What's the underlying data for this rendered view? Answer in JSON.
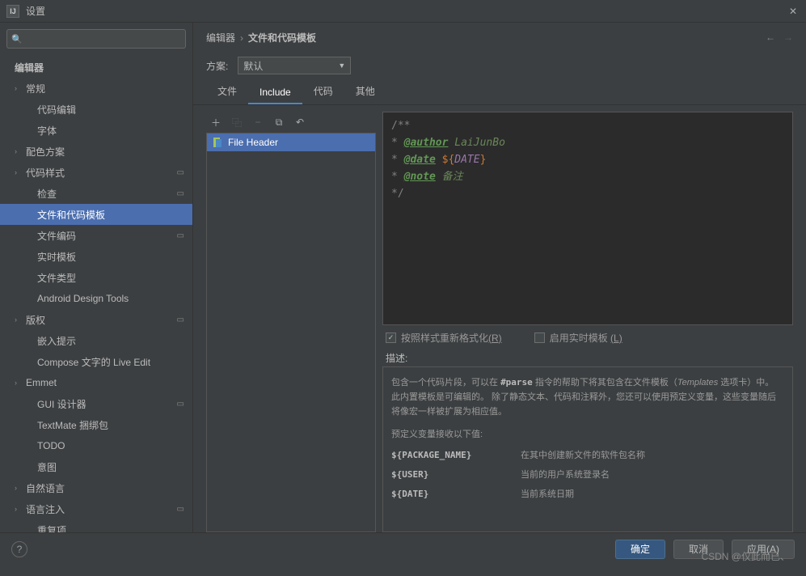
{
  "window": {
    "title": "设置"
  },
  "sidebar": {
    "search_placeholder": "",
    "root": "编辑器",
    "items": [
      {
        "label": "常规",
        "chev": true,
        "lvl": 1,
        "modified": false
      },
      {
        "label": "代码编辑",
        "chev": false,
        "lvl": 2,
        "modified": false
      },
      {
        "label": "字体",
        "chev": false,
        "lvl": 2,
        "modified": false
      },
      {
        "label": "配色方案",
        "chev": true,
        "lvl": 1,
        "modified": false
      },
      {
        "label": "代码样式",
        "chev": true,
        "lvl": 1,
        "modified": true
      },
      {
        "label": "检查",
        "chev": false,
        "lvl": 2,
        "modified": true
      },
      {
        "label": "文件和代码模板",
        "chev": false,
        "lvl": 2,
        "modified": false,
        "selected": true
      },
      {
        "label": "文件编码",
        "chev": false,
        "lvl": 2,
        "modified": true
      },
      {
        "label": "实时模板",
        "chev": false,
        "lvl": 2,
        "modified": false
      },
      {
        "label": "文件类型",
        "chev": false,
        "lvl": 2,
        "modified": false
      },
      {
        "label": "Android Design Tools",
        "chev": false,
        "lvl": 2,
        "modified": false
      },
      {
        "label": "版权",
        "chev": true,
        "lvl": 1,
        "modified": true
      },
      {
        "label": "嵌入提示",
        "chev": false,
        "lvl": 2,
        "modified": false
      },
      {
        "label": "Compose 文字的 Live Edit",
        "chev": false,
        "lvl": 2,
        "modified": false
      },
      {
        "label": "Emmet",
        "chev": true,
        "lvl": 1,
        "modified": false
      },
      {
        "label": "GUI 设计器",
        "chev": false,
        "lvl": 2,
        "modified": true
      },
      {
        "label": "TextMate 捆绑包",
        "chev": false,
        "lvl": 2,
        "modified": false
      },
      {
        "label": "TODO",
        "chev": false,
        "lvl": 2,
        "modified": false
      },
      {
        "label": "意图",
        "chev": false,
        "lvl": 2,
        "modified": false
      },
      {
        "label": "自然语言",
        "chev": true,
        "lvl": 1,
        "modified": false
      },
      {
        "label": "语言注入",
        "chev": true,
        "lvl": 1,
        "modified": true
      },
      {
        "label": "重复项",
        "chev": false,
        "lvl": 2,
        "modified": false
      }
    ]
  },
  "breadcrumb": {
    "a": "编辑器",
    "b": "文件和代码模板"
  },
  "scheme": {
    "label": "方案:",
    "value": "默认"
  },
  "tabs": [
    {
      "label": "文件",
      "active": false
    },
    {
      "label": "Include",
      "active": true
    },
    {
      "label": "代码",
      "active": false
    },
    {
      "label": "其他",
      "active": false
    }
  ],
  "templates": {
    "selected": "File Header"
  },
  "editor": {
    "l1": "/**",
    "l2a": "* ",
    "l2tag": "@author",
    "l2b": " LaiJunBo",
    "l3a": "* ",
    "l3tag": "@date",
    "l3b": " ",
    "l3var": "${",
    "l3name": "DATE",
    "l3end": "}",
    "l4a": "* ",
    "l4tag": "@note",
    "l4b": " 备注",
    "l5": "*/"
  },
  "checks": {
    "reformat": "按照样式重新格式化",
    "reformat_key": "(R)",
    "live": "启用实时模板 ",
    "live_key": "(L)"
  },
  "desc": {
    "label": "描述:",
    "p1a": "包含一个代码片段，可以在 ",
    "p1b": "#parse",
    "p1c": " 指令的帮助下将其包含在文件模板（",
    "p1d": "Templates",
    "p1e": " 选项卡）中。",
    "p2": "此内置模板是可编辑的。 除了静态文本、代码和注释外，您还可以使用预定义变量，这些变量随后将像宏一样被扩展为相应值。",
    "p3": "预定义变量接收以下值:",
    "vars": [
      {
        "k": "${PACKAGE_NAME}",
        "v": "在其中创建新文件的软件包名称"
      },
      {
        "k": "${USER}",
        "v": "当前的用户系统登录名"
      },
      {
        "k": "${DATE}",
        "v": "当前系统日期"
      }
    ]
  },
  "footer": {
    "ok": "确定",
    "cancel": "取消",
    "apply": "应用(A)"
  },
  "watermark": "CSDN @仅此而已、"
}
